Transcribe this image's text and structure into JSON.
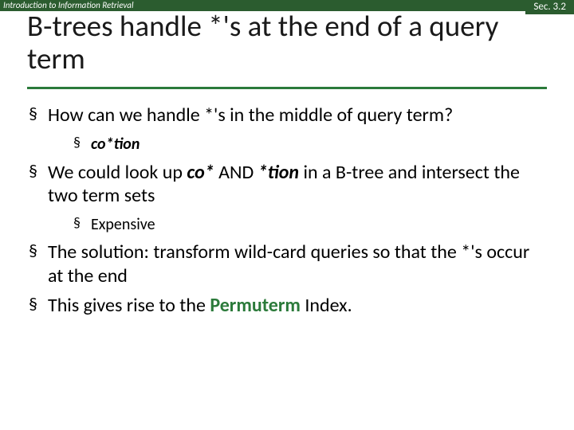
{
  "header": {
    "course": "Introduction to Information Retrieval",
    "section": "Sec. 3.2"
  },
  "title": "B-trees handle *'s at the end of a query term",
  "bullets": {
    "b1": "How can we handle *'s in the middle of query term?",
    "b1_sub": "co*tion",
    "b2_pre": "We could look up ",
    "b2_term1": "co*",
    "b2_mid": " AND ",
    "b2_term2": "*tion",
    "b2_post": " in a B-tree and intersect the two term sets",
    "b2_sub": "Expensive",
    "b3": "The solution: transform wild-card queries so that the *'s occur at the end",
    "b4_pre": "This gives rise to the ",
    "b4_term": "Permuterm",
    "b4_post": " Index."
  }
}
